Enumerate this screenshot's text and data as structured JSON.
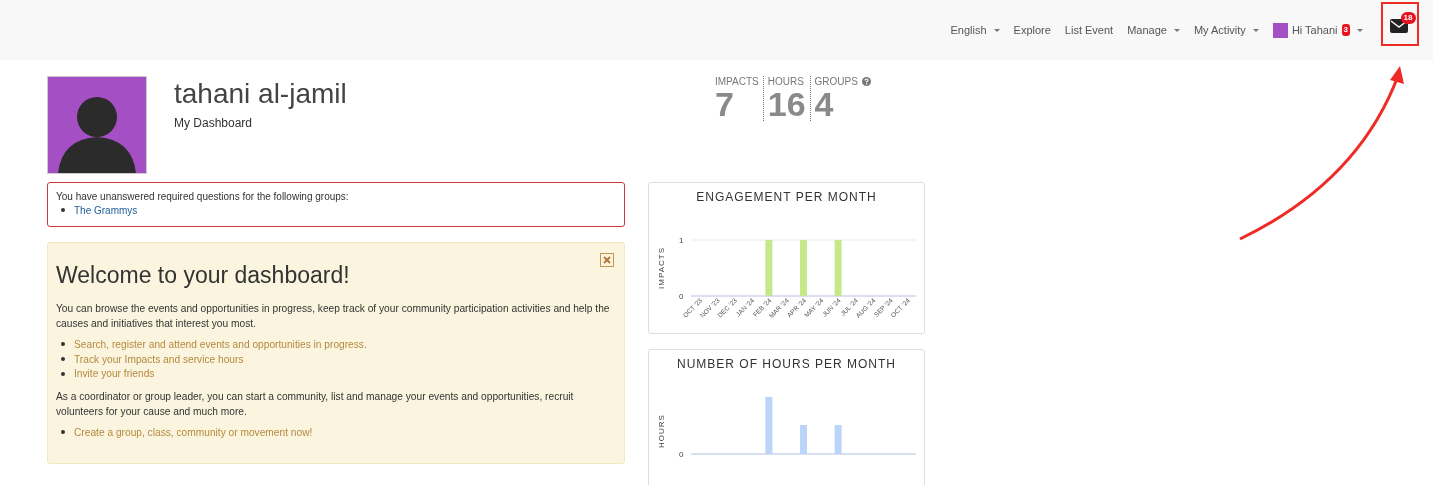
{
  "navbar": {
    "items": [
      {
        "label": "English",
        "kind": "dropdown"
      },
      {
        "label": "Explore",
        "kind": "link"
      },
      {
        "label": "List Event",
        "kind": "link"
      },
      {
        "label": "Manage",
        "kind": "dropdown"
      },
      {
        "label": "My Activity",
        "kind": "dropdown"
      },
      {
        "label": "Hi Tahani",
        "kind": "user",
        "badge": "3"
      }
    ],
    "messages_badge": "18"
  },
  "profile": {
    "name": "tahani al-jamil",
    "subtitle": "My Dashboard"
  },
  "stats": [
    {
      "label": "IMPACTS",
      "value": "7",
      "help": false
    },
    {
      "label": "HOURS",
      "value": "16",
      "help": false
    },
    {
      "label": "GROUPS",
      "value": "4",
      "help": true
    }
  ],
  "alert": {
    "text": "You have unanswered required questions for the following groups:",
    "links": [
      "The Grammys"
    ]
  },
  "welcome": {
    "title": "Welcome to your dashboard!",
    "intro": "You can browse the events and opportunities in progress, keep track of your community participation activities and help the causes and initiatives that interest you most.",
    "links": [
      "Search, register and attend events and opportunities in progress.",
      "Track your Impacts and service hours",
      "Invite your friends"
    ],
    "coordinator_text": "As a coordinator or group leader, you can start a community, list and manage your events and opportunities, recruit volunteers for your cause and much more.",
    "coordinator_links": [
      "Create a group, class, community or movement now!"
    ]
  },
  "engagement_chart": {
    "chart_data": {
      "type": "bar",
      "title": "ENGAGEMENT PER MONTH",
      "ylabel": "IMPACTS",
      "categories": [
        "OCT '23",
        "NOV '23",
        "DEC '23",
        "JAN '24",
        "FEB '24",
        "MAR '24",
        "APR '24",
        "MAY '24",
        "JUN '24",
        "JUL '24",
        "AUG '24",
        "SEP '24",
        "OCT '24"
      ],
      "series": [
        {
          "color": "#c5e88a",
          "values": [
            0,
            0,
            0,
            0,
            1,
            0,
            1,
            0,
            1,
            0,
            0,
            0,
            0
          ]
        }
      ],
      "ylim": [
        0,
        1
      ],
      "yticks": [
        0,
        1
      ]
    }
  },
  "hours_chart": {
    "title": "NUMBER OF HOURS PER MONTH",
    "ylabel": "HOURS",
    "ytick": "0"
  }
}
